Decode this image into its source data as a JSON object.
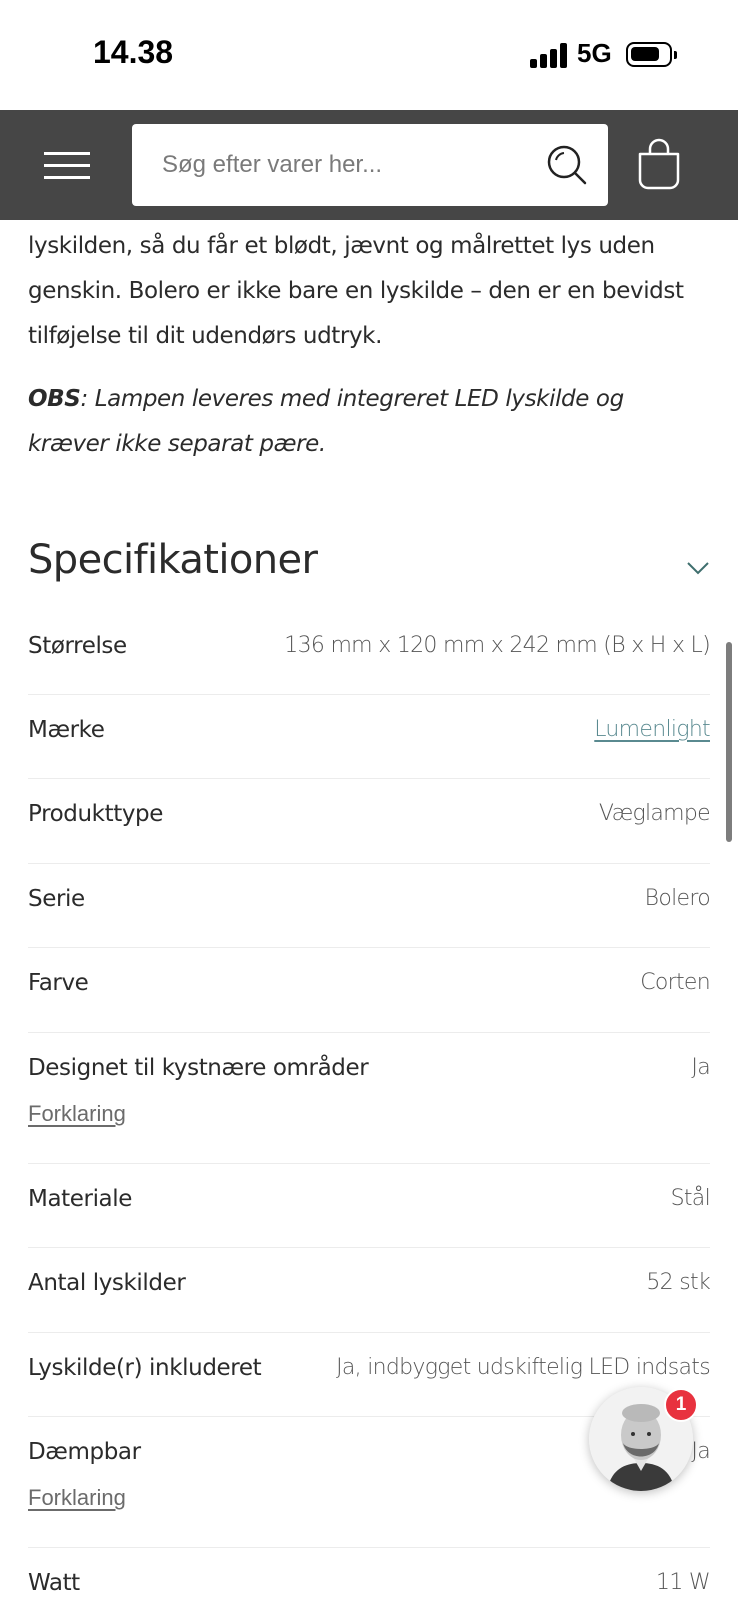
{
  "status_bar": {
    "time": "14.38",
    "network": "5G"
  },
  "header": {
    "search_placeholder": "Søg efter varer her..."
  },
  "description": {
    "lines": [
      "lyskilden, så du får et blødt, jævnt og målrettet lys uden",
      "genskin. Bolero er ikke bare en lyskilde – den er en bevidst",
      "tilføjelse til dit udendørs udtryk."
    ],
    "obs_label": "OBS",
    "obs_line1": ": Lampen leveres med integreret LED lyskilde og",
    "obs_line2": "kræver ikke separat pære."
  },
  "specifications": {
    "heading": "Specifikationer",
    "forklaring": "Forklaring",
    "rows": [
      {
        "label": "Størrelse",
        "value": "136 mm x 120 mm x 242 mm (B x H x L)"
      },
      {
        "label": "Mærke",
        "value": "Lumenlight"
      },
      {
        "label": "Produkttype",
        "value": "Væglampe"
      },
      {
        "label": "Serie",
        "value": "Bolero"
      },
      {
        "label": "Farve",
        "value": "Corten"
      },
      {
        "label": "Designet til kystnære områder",
        "value": "Ja"
      },
      {
        "label": "Materiale",
        "value": "Stål"
      },
      {
        "label": "Antal lyskilder",
        "value": "52 stk"
      },
      {
        "label": "Lyskilde(r) inkluderet",
        "value": "Ja, indbygget udskiftelig LED indsats"
      },
      {
        "label": "Dæmpbar",
        "value": "Ja"
      },
      {
        "label": "Watt",
        "value": "11 W"
      }
    ]
  },
  "chat": {
    "badge_count": "1"
  },
  "colors": {
    "header_bg": "#464646",
    "link": "#5a8a90",
    "badge": "#e8323f"
  },
  "icons": [
    "menu-icon",
    "search-icon",
    "shopping-bag-icon",
    "chevron-down-icon"
  ]
}
